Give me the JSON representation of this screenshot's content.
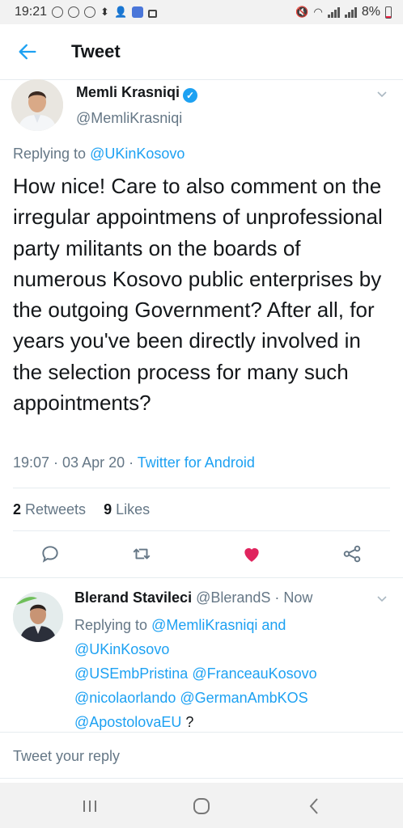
{
  "status_bar": {
    "time": "19:21",
    "battery": "8%"
  },
  "header": {
    "title": "Tweet"
  },
  "tweet": {
    "author_name": "Memli Krasniqi",
    "author_handle": "@MemliKrasniqi",
    "replying_prefix": "Replying to ",
    "replying_to": "@UKinKosovo",
    "text": "How nice! Care to also comment on the irregular appointmens of unprofessional party militants on the boards of numerous Kosovo public enterprises by the outgoing Government? After all, for years you've been directly involved in the selection process for many such appointments?",
    "timestamp": "19:07 · 03 Apr 20 · ",
    "source": "Twitter for Android",
    "retweets_count": "2",
    "retweets_label": " Retweets",
    "likes_count": "9",
    "likes_label": " Likes"
  },
  "reply": {
    "author_name": "Blerand Stavileci",
    "author_handle": "@BlerandS · Now",
    "replying_prefix": "Replying to ",
    "mention_1": "@MemliKrasniqi",
    "and_word": " and",
    "mention_2": "@UKinKosovo",
    "mention_3": "@USEmbPristina",
    "mention_4": "@FranceauKosovo",
    "mention_5": "@nicolaorlando",
    "mention_6": "@GermanAmbKOS",
    "mention_7": "@ApostolovaEU",
    "trailing": " ?"
  },
  "compose": {
    "placeholder": "Tweet your reply"
  },
  "colors": {
    "accent": "#1da1f2",
    "like": "#e0245e",
    "muted": "#657786"
  },
  "icons": [
    "back-arrow-icon",
    "verified-badge-icon",
    "chevron-down-icon",
    "reply-icon",
    "retweet-icon",
    "heart-icon",
    "share-icon",
    "recents-icon",
    "home-icon",
    "back-nav-icon"
  ]
}
